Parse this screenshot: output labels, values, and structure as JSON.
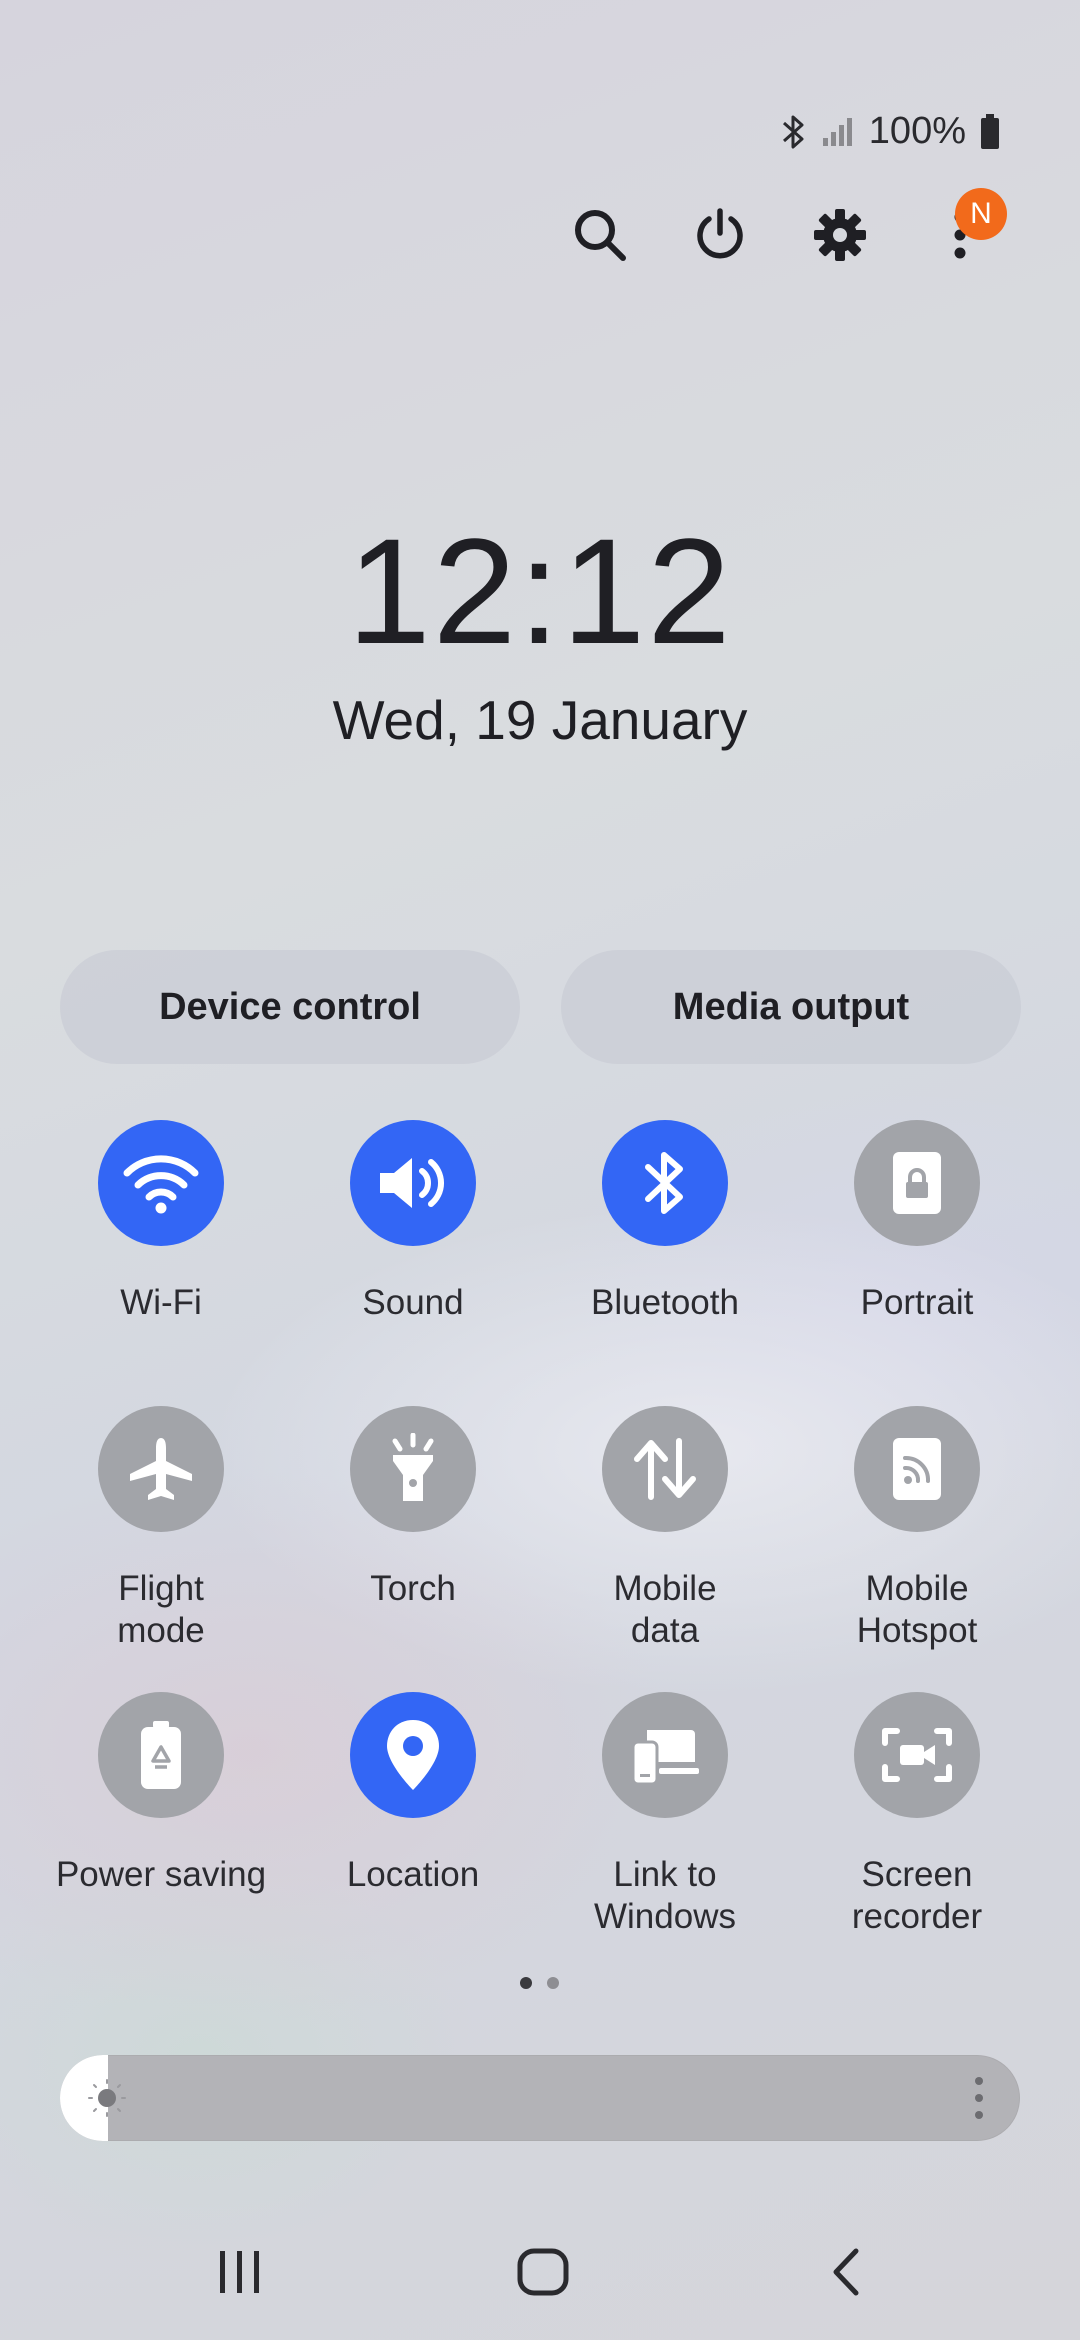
{
  "status_bar": {
    "battery_text": "100%",
    "icons": [
      "bluetooth-icon",
      "signal-icon",
      "battery-icon"
    ]
  },
  "top_actions": {
    "icons": [
      "search-icon",
      "power-icon",
      "gear-icon",
      "more-vertical-icon"
    ],
    "badge": "N",
    "badge_color": "#f26a1b"
  },
  "clock": {
    "time": "12:12",
    "date": "Wed, 19 January"
  },
  "pills": {
    "device_control": "Device control",
    "media_output": "Media output"
  },
  "accent_color": "#3366f5",
  "tiles": [
    {
      "label": "Wi-Fi",
      "active": true,
      "icon": "wifi-icon"
    },
    {
      "label": "Sound",
      "active": true,
      "icon": "speaker-icon"
    },
    {
      "label": "Bluetooth",
      "active": true,
      "icon": "bluetooth-icon"
    },
    {
      "label": "Portrait",
      "active": false,
      "icon": "portrait-lock-icon"
    },
    {
      "label": "Flight\nmode",
      "active": false,
      "icon": "airplane-icon"
    },
    {
      "label": "Torch",
      "active": false,
      "icon": "flashlight-icon"
    },
    {
      "label": "Mobile\ndata",
      "active": false,
      "icon": "data-arrows-icon"
    },
    {
      "label": "Mobile\nHotspot",
      "active": false,
      "icon": "hotspot-icon"
    },
    {
      "label": "Power saving",
      "active": false,
      "icon": "battery-saver-icon"
    },
    {
      "label": "Location",
      "active": true,
      "icon": "location-pin-icon"
    },
    {
      "label": "Link to\nWindows",
      "active": false,
      "icon": "link-windows-icon"
    },
    {
      "label": "Screen\nrecorder",
      "active": false,
      "icon": "screen-recorder-icon"
    }
  ],
  "pager": {
    "current": 1,
    "total": 2
  },
  "brightness": {
    "level": 0.05
  },
  "nav": {
    "icons": [
      "recent-apps-icon",
      "home-icon",
      "back-icon"
    ]
  }
}
